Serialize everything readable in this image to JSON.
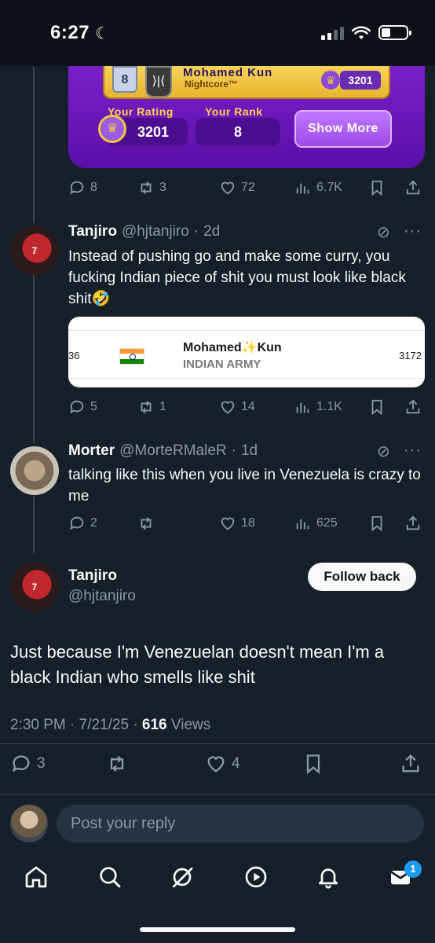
{
  "status_bar": {
    "time": "6:27",
    "moon": "☾"
  },
  "game_card": {
    "level": "8",
    "shield": "⟩|⟨",
    "player_name": "Mohamed Kun",
    "subtitle": "Nightcore™",
    "top_rating": "3201",
    "your_rating_label": "Your Rating",
    "your_rating": "3201",
    "your_rank_label": "Your Rank",
    "your_rank": "8",
    "show_more": "Show More"
  },
  "quoted_tweet_actions": {
    "replies": "8",
    "reposts": "3",
    "likes": "72",
    "views": "6.7K"
  },
  "reply1": {
    "name": "Tanjiro",
    "handle": "@hjtanjiro",
    "sep": "·",
    "time": "2d",
    "text": "Instead of pushing go and make some curry, you fucking Indian piece of shit you must look like black shit🤣",
    "embed": {
      "rank": "36",
      "player": "Mohamed✨Kun",
      "team": "INDIAN ARMY",
      "score": "3172"
    },
    "actions": {
      "replies": "5",
      "reposts": "1",
      "likes": "14",
      "views": "1.1K"
    }
  },
  "reply2": {
    "name": "Morter",
    "handle": "@MorteRMaleR",
    "sep": "·",
    "time": "1d",
    "text": "talking like this when you live in Venezuela is crazy to me",
    "actions": {
      "replies": "2",
      "likes": "18",
      "views": "625"
    }
  },
  "main_tweet": {
    "name": "Tanjiro",
    "handle": "@hjtanjiro",
    "follow_label": "Follow back",
    "text": "Just because I'm Venezuelan doesn't mean I'm a black Indian who smells like shit",
    "time_date": "2:30 PM · 7/21/25 · ",
    "views_count": "616",
    "views_label": " Views",
    "actions": {
      "replies": "3",
      "likes": "4"
    }
  },
  "reply_box": {
    "placeholder": "Post your reply"
  },
  "nav": {
    "messages_badge": "1"
  }
}
